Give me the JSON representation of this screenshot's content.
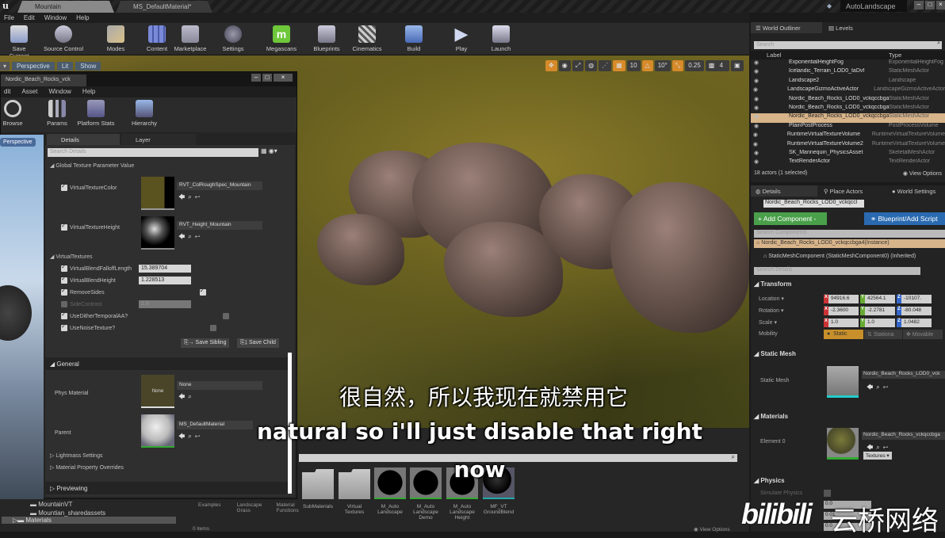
{
  "titlebar": {
    "tabs": [
      "Mountain",
      "MS_DefaultMaterial*"
    ],
    "project": "AutoLandscape"
  },
  "menu": [
    "File",
    "Edit",
    "Window",
    "Help"
  ],
  "toolbar": [
    "Save Current",
    "Source Control",
    "Modes",
    "Content",
    "Marketplace",
    "Settings",
    "Megascans",
    "Blueprints",
    "Cinematics",
    "Build",
    "Play",
    "Launch"
  ],
  "viewport": {
    "buttons": [
      "Perspective",
      "Lit",
      "Show"
    ],
    "snap": {
      "grid": "10",
      "rotation": "10°",
      "scale": "0.25",
      "camera_speed": "4"
    }
  },
  "material_window": {
    "tab": "Nordic_Beach_Rocks_vck",
    "menu": [
      "dit",
      "Asset",
      "Window",
      "Help"
    ],
    "tools": [
      "Browse",
      "Params",
      "Platform Stats",
      "Hierarchy"
    ],
    "tabs": [
      "Details",
      "Layer Parameters"
    ],
    "search_placeholder": "Search Details",
    "sections": {
      "global": "Global Texture Parameter Value",
      "virtual": "VirtualTextures",
      "general": "General",
      "lightmass": "Lightmass Settings",
      "overrides": "Material Property Overrides",
      "previewing": "Previewing"
    },
    "textures": [
      {
        "label": "VirtualTextureColor",
        "value": "RVT_ColRoughSpec_Mountain"
      },
      {
        "label": "VirtualTextureHeight",
        "value": "RVT_Height_Mountain"
      }
    ],
    "params": [
      {
        "label": "VirtualBlendFalloffLength",
        "value": "15.389704"
      },
      {
        "label": "VirtualBlendHeight",
        "value": "1.228513"
      },
      {
        "label": "RemoveSides"
      },
      {
        "label": "SideContrast",
        "value": "1.0"
      },
      {
        "label": "UseDitherTemporalAA?"
      },
      {
        "label": "UseNoiseTexture?"
      }
    ],
    "save_sibling": "Save Sibling",
    "save_child": "Save Child",
    "phys_material": {
      "label": "Phys Material",
      "value": "None",
      "thumb": "None"
    },
    "parent": {
      "label": "Parent",
      "value": "MS_DefaultMaterial"
    }
  },
  "left_viewport": {
    "tab": "Perspective"
  },
  "folders": [
    "MountainVT",
    "Mountian_sharedassets",
    "Materials"
  ],
  "content": {
    "column_labels": [
      "Examples",
      "Landscape Grass",
      "Material Functions"
    ],
    "items_count": "0 items",
    "assets": [
      {
        "name": "SubMaterials"
      },
      {
        "name": "Virtual Textures"
      },
      {
        "name": "M_Auto Landscape"
      },
      {
        "name": "M_Auto Landscape Demo"
      },
      {
        "name": "M_Auto Landscape Height"
      },
      {
        "name": "MF_VT GroundBlend"
      }
    ],
    "view_options": "View Options"
  },
  "outliner": {
    "tabs": [
      "World Outliner",
      "Levels"
    ],
    "search_placeholder": "Search",
    "col_label": "Label",
    "col_type": "Type",
    "rows": [
      {
        "label": "ExponentialHeightFog",
        "type": "ExponentialHeightFog"
      },
      {
        "label": "Icelandic_Terrain_LOD0_taDvf",
        "type": "StaticMeshActor"
      },
      {
        "label": "Landscape2",
        "type": "Landscape"
      },
      {
        "label": "LandscapeGizmoActiveActor",
        "type": "LandscapeGizmoActiveActor"
      },
      {
        "label": "Nordic_Beach_Rocks_LOD0_vckqccbga",
        "type": "StaticMeshActor"
      },
      {
        "label": "Nordic_Beach_Rocks_LOD0_vckqccbga",
        "type": "StaticMeshActor"
      },
      {
        "label": "Nordic_Beach_Rocks_LOD0_vckqccbga",
        "type": "StaticMeshActor",
        "selected": true
      },
      {
        "label": "PlainPostProcess",
        "type": "PostProcessVolume"
      },
      {
        "label": "RuntimeVirtualTextureVolume",
        "type": "RuntimeVirtualTextureVolume"
      },
      {
        "label": "RuntimeVirtualTextureVolume2",
        "type": "RuntimeVirtualTextureVolume"
      },
      {
        "label": "SK_Mannequin_PhysicsAsset",
        "type": "SkeletalMeshActor"
      },
      {
        "label": "TextRenderActor",
        "type": "TextRenderActor"
      }
    ],
    "status": "18 actors (1 selected)",
    "view_options": "View Options"
  },
  "details": {
    "tabs": [
      "Details",
      "Place Actors",
      "World Settings"
    ],
    "actor_name": "Nordic_Beach_Rocks_LOD0_vckqccl",
    "add_component": "+ Add Component -",
    "blueprint": "Blueprint/Add Script",
    "search_components": "Search Components",
    "instance": "Nordic_Beach_Rocks_LOD0_vckqccbga4(Instance)",
    "component": "StaticMeshComponent (StaticMeshComponent0) (Inherited)",
    "search_details": "Search Details",
    "transform": "Transform",
    "location": {
      "label": "Location",
      "x": "94916.6",
      "y": "42564.1",
      "z": "-10107."
    },
    "rotation": {
      "label": "Rotation",
      "x": "-2.3600",
      "y": "-2.2781",
      "z": "-80.048"
    },
    "scale": {
      "label": "Scale",
      "x": "1.0",
      "y": "1.0",
      "z": "1.0482"
    },
    "mobility": {
      "label": "Mobility",
      "options": [
        "Static",
        "Stationa",
        "Movable"
      ]
    },
    "static_mesh_section": "Static Mesh",
    "static_mesh_label": "Static Mesh",
    "static_mesh_value": "Nordic_Beach_Rocks_LOD0_vck",
    "materials_section": "Materials",
    "element0": "Element 0",
    "element0_value": "Nordic_Beach_Rocks_vckqccbga",
    "textures_btn": "Textures",
    "physics_section": "Physics",
    "simulate": "Simulate Physics",
    "phys_vals": [
      "0.0",
      "0.01",
      "0.0"
    ]
  },
  "subtitles": {
    "zh": "很自然，所以我现在就禁用它",
    "en1": "natural so i'll just disable that right",
    "en2": "now"
  },
  "watermark": {
    "logo": "bilibili",
    "text": "云桥网络"
  }
}
